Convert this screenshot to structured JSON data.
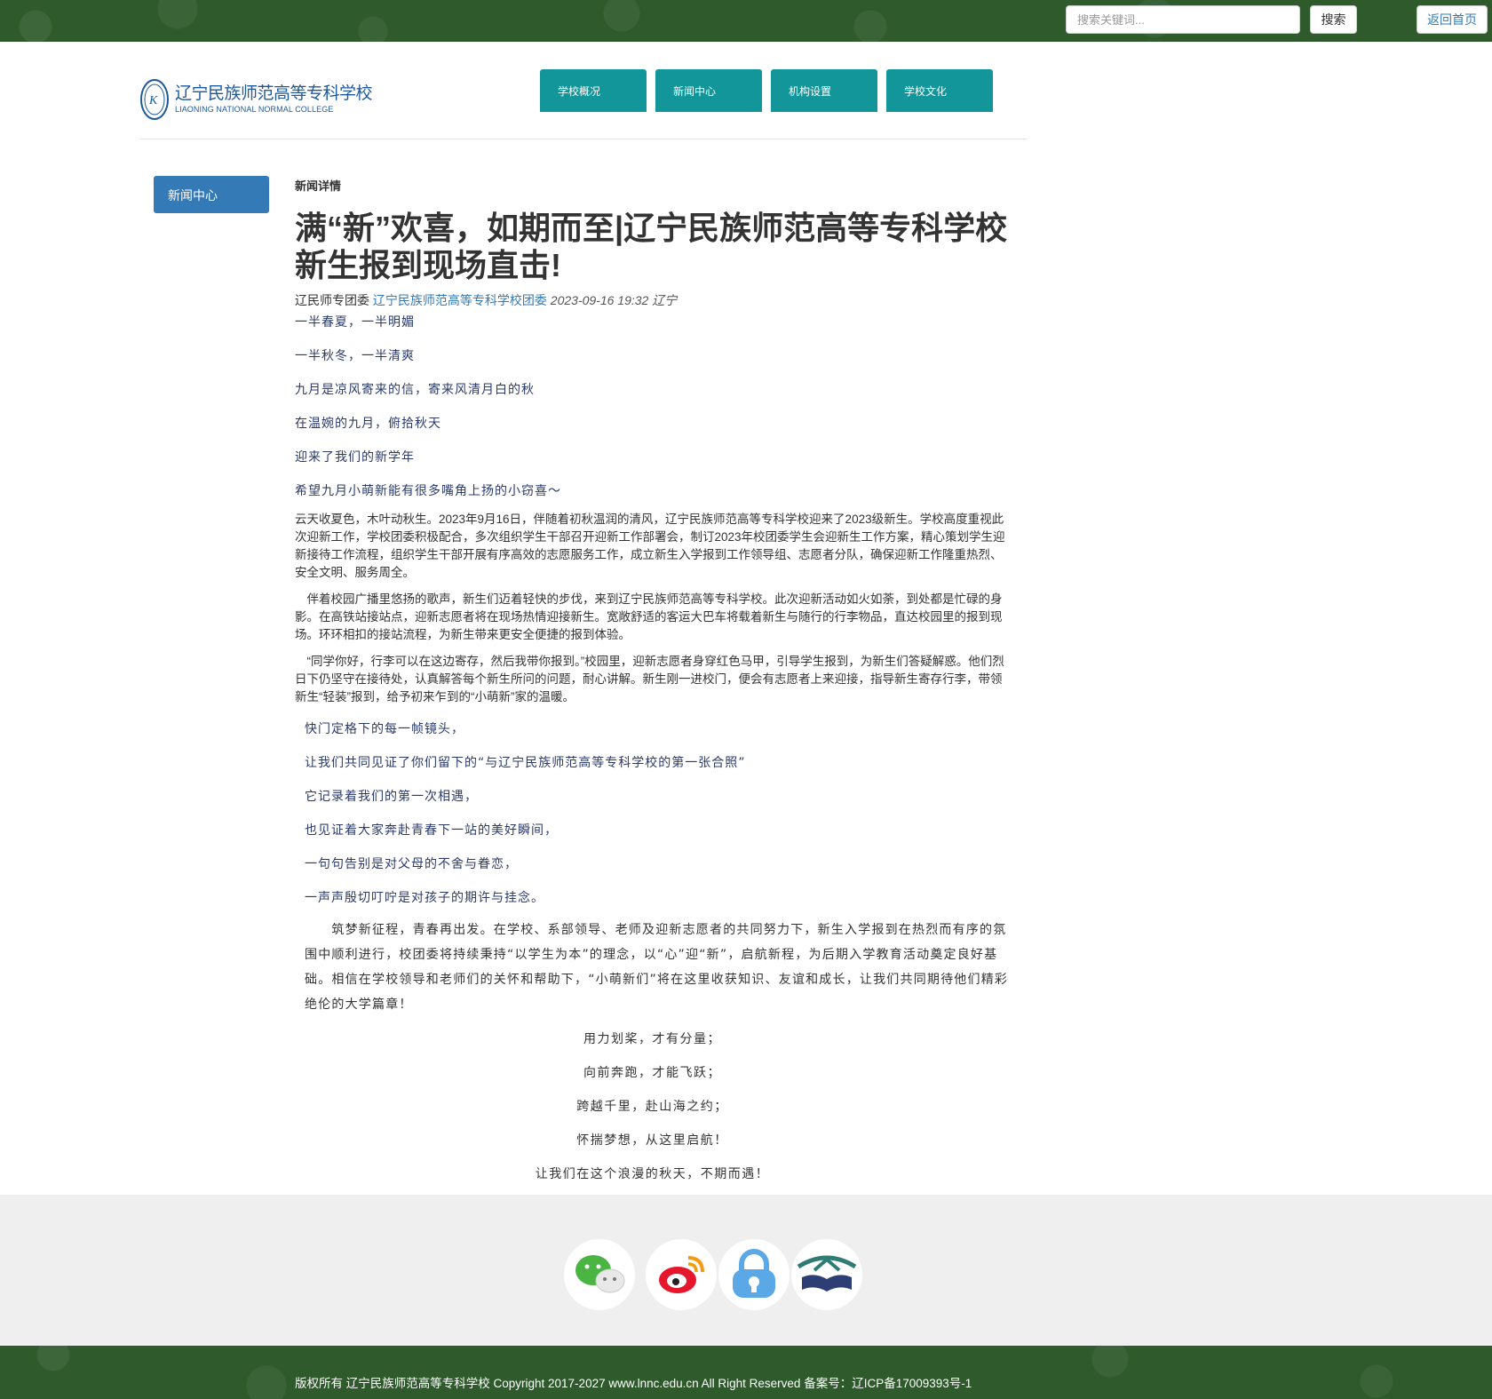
{
  "topbar": {
    "search_placeholder": "搜索关键词...",
    "search_label": "搜索",
    "home_label": "返回首页"
  },
  "header": {
    "logo_cn": "辽宁民族师范高等专科学校",
    "logo_en": "LIAONING NATIONAL NORMAL COLLEGE",
    "nav": [
      "学校概况",
      "新闻中心",
      "机构设置",
      "学校文化"
    ]
  },
  "sidebar": {
    "active_label": "新闻中心"
  },
  "article": {
    "breadcrumb": "新闻详情",
    "title": "满“新”欢喜，如期而至|辽宁民族师范高等专科学校新生报到现场直击!",
    "meta_source": "辽民师专团委",
    "meta_link": "辽宁民族师范高等专科学校团委",
    "meta_time": "2023-09-16 19:32 辽宁",
    "intro_lines": [
      "一半春夏，一半明媚",
      "一半秋冬，一半清爽",
      "九月是凉风寄来的信，寄来风清月白的秋",
      "在温婉的九月，俯拾秋天",
      "迎来了我们的新学年",
      "希望九月小萌新能有很多嘴角上扬的小窃喜～"
    ],
    "paragraphs": [
      "云天收夏色，木叶动秋生。2023年9月16日，伴随着初秋温润的清风，辽宁民族师范高等专科学校迎来了2023级新生。学校高度重视此次迎新工作，学校团委积极配合，多次组织学生干部召开迎新工作部署会，制订2023年校团委学生会迎新生工作方案，精心策划学生迎新接待工作流程，组织学生干部开展有序高效的志愿服务工作，成立新生入学报到工作领导组、志愿者分队，确保迎新工作隆重热烈、安全文明、服务周全。",
      "　伴着校园广播里悠扬的歌声，新生们迈着轻快的步伐，来到辽宁民族师范高等专科学校。此次迎新活动如火如荼，到处都是忙碌的身影。在高铁站接站点，迎新志愿者将在现场热情迎接新生。宽敞舒适的客运大巴车将载着新生与随行的行李物品，直达校园里的报到现场。环环相扣的接站流程，为新生带来更安全便捷的报到体验。",
      "　“同学你好，行李可以在这边寄存，然后我带你报到。”校园里，迎新志愿者身穿红色马甲，引导学生报到，为新生们答疑解惑。他们烈日下仍坚守在接待处，认真解答每个新生所问的问题，耐心讲解。新生刚一进校门，便会有志愿者上来迎接，指导新生寄存行李，带领新生“轻装”报到，给予初来乍到的“小萌新”家的温暖。"
    ],
    "mid_lines": [
      "快门定格下的每一帧镜头，",
      "让我们共同见证了你们留下的“与辽宁民族师范高等专科学校的第一张合照”",
      "它记录着我们的第一次相遇，",
      "也见证着大家奔赴青春下一站的美好瞬间，",
      "一句句告别是对父母的不舍与眷恋，",
      "一声声殷切叮咛是对孩子的期许与挂念。"
    ],
    "closing_paragraph": "　　筑梦新征程，青春再出发。在学校、系部领导、老师及迎新志愿者的共同努力下，新生入学报到在热烈而有序的氛围中顺利进行，校团委将持续秉持“以学生为本”的理念，以“心”迎“新”，启航新程，为后期入学教育活动奠定良好基础。相信在学校领导和老师们的关怀和帮助下，“小萌新们”将在这里收获知识、友谊和成长，让我们共同期待他们精彩绝伦的大学篇章！",
    "center_lines": [
      "用力划桨，才有分量；",
      "向前奔跑，才能飞跃；",
      "跨越千里，赴山海之约；",
      "怀揣梦想，从这里启航！",
      "让我们在这个浪漫的秋天，不期而遇！"
    ]
  },
  "footer": {
    "social_icons": [
      "wechat-icon",
      "weibo-icon",
      "lock-icon",
      "book-icon"
    ],
    "copyright": "版权所有 辽宁民族师范高等专科学校 Copyright 2017-2027 www.lnnc.edu.cn All Right Reserved 备案号：辽ICP备17009393号-1"
  },
  "colors": {
    "top_green": "#2e5a2c",
    "nav_teal": "#12969a",
    "sidebar_blue": "#337ab7",
    "text_navy": "#2b3a6b"
  }
}
